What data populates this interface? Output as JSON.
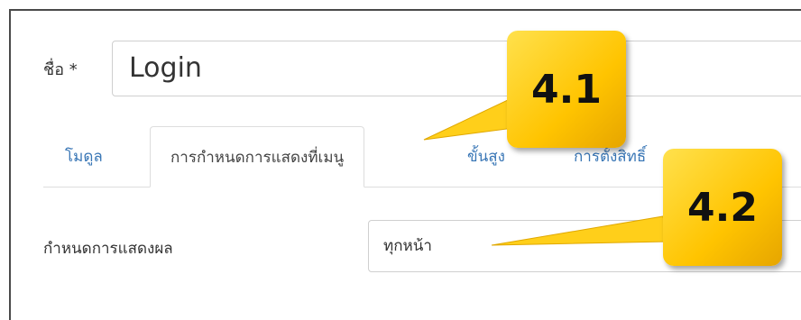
{
  "form": {
    "name_label": "ชื่อ *",
    "name_value": "Login"
  },
  "tabs": [
    {
      "label": "โมดูล",
      "active": false
    },
    {
      "label": "การกำหนดการแสดงที่เมนู",
      "active": true
    },
    {
      "label": "ขั้นสูง",
      "active": false
    },
    {
      "label": "การตั้งสิทธิ์",
      "active": false
    }
  ],
  "assignment": {
    "label": "กำหนดการแสดงผล",
    "selected": "ทุกหน้า"
  },
  "callouts": [
    {
      "text": "4.1"
    },
    {
      "text": "4.2"
    }
  ],
  "colors": {
    "callout": "#ffc400",
    "tab_link": "#3a77b6",
    "border": "#dddddd"
  }
}
